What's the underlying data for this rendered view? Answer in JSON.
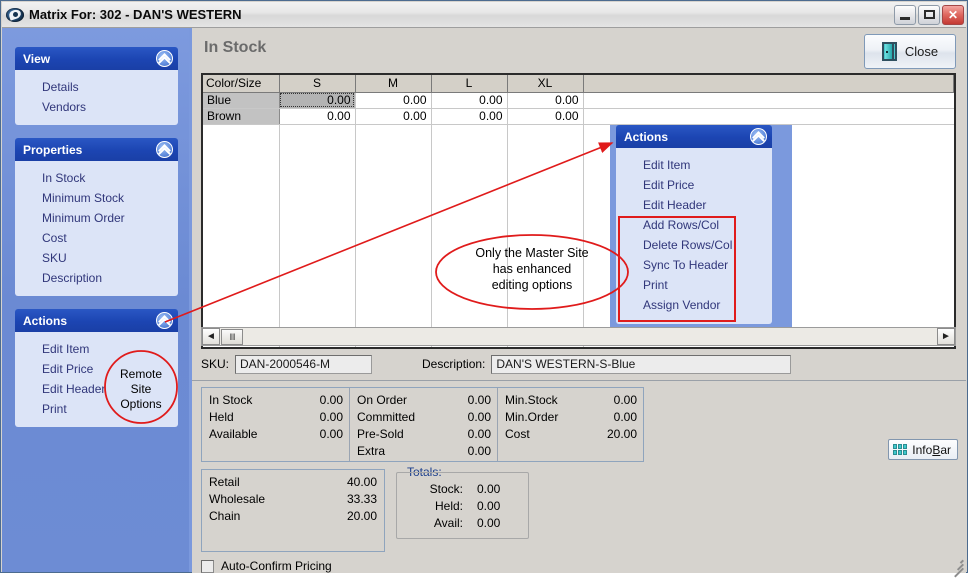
{
  "window": {
    "title": "Matrix For: 302 - DAN'S WESTERN",
    "app_icon": "matrix-logo-icon",
    "minimize_label": "_",
    "maximize_label": "□",
    "close_label": "✕"
  },
  "content": {
    "page_title": "In Stock",
    "close_button": {
      "label": "Close",
      "icon": "exit-door-icon"
    }
  },
  "sidebar": {
    "panels": [
      {
        "title": "View",
        "collapse_icon": "chevron-up-icon",
        "items": [
          {
            "label": "Details"
          },
          {
            "label": "Vendors"
          }
        ]
      },
      {
        "title": "Properties",
        "collapse_icon": "chevron-up-icon",
        "items": [
          {
            "label": "In Stock"
          },
          {
            "label": "Minimum Stock"
          },
          {
            "label": "Minimum Order"
          },
          {
            "label": "Cost"
          },
          {
            "label": "SKU"
          },
          {
            "label": "Description"
          }
        ]
      },
      {
        "title": "Actions",
        "collapse_icon": "chevron-up-icon",
        "items": [
          {
            "label": "Edit Item"
          },
          {
            "label": "Edit Price"
          },
          {
            "label": "Edit Header"
          },
          {
            "label": "Print"
          }
        ]
      }
    ]
  },
  "floating_actions": {
    "title": "Actions",
    "collapse_icon": "chevron-up-icon",
    "items": [
      {
        "label": "Edit Item",
        "highlighted": false
      },
      {
        "label": "Edit Price",
        "highlighted": false
      },
      {
        "label": "Edit Header",
        "highlighted": false
      },
      {
        "label": "Add Rows/Col",
        "highlighted": true
      },
      {
        "label": "Delete Rows/Col",
        "highlighted": true
      },
      {
        "label": "Sync To Header",
        "highlighted": true
      },
      {
        "label": "Print",
        "highlighted": true
      },
      {
        "label": "Assign Vendor",
        "highlighted": true
      }
    ]
  },
  "matrix": {
    "columns": [
      "Color/Size",
      "S",
      "M",
      "L",
      "XL",
      ""
    ],
    "rows": [
      {
        "label": "Blue",
        "values": [
          "0.00",
          "0.00",
          "0.00",
          "0.00"
        ],
        "selected_index": 0
      },
      {
        "label": "Brown",
        "values": [
          "0.00",
          "0.00",
          "0.00",
          "0.00"
        ],
        "selected_index": -1
      }
    ],
    "scrollbar": {
      "left_arrow": "◄",
      "right_arrow": "►",
      "thumb_grip": "‖‖"
    }
  },
  "fields": {
    "sku_label": "SKU:",
    "sku_value": "DAN-2000546-M",
    "description_label": "Description:",
    "description_value": "DAN'S WESTERN-S-Blue"
  },
  "stats": {
    "column1": [
      {
        "key": "In Stock",
        "value": "0.00"
      },
      {
        "key": "Held",
        "value": "0.00"
      },
      {
        "key": "Available",
        "value": "0.00"
      }
    ],
    "column2": [
      {
        "key": "On Order",
        "value": "0.00"
      },
      {
        "key": "Committed",
        "value": "0.00"
      },
      {
        "key": "Pre-Sold",
        "value": "0.00"
      },
      {
        "key": "Extra",
        "value": "0.00"
      }
    ],
    "column3": [
      {
        "key": "Min.Stock",
        "value": "0.00"
      },
      {
        "key": "Min.Order",
        "value": "0.00"
      },
      {
        "key": "Cost",
        "value": "20.00"
      }
    ]
  },
  "pricing": [
    {
      "key": "Retail",
      "value": "40.00"
    },
    {
      "key": "Wholesale",
      "value": "33.33"
    },
    {
      "key": "Chain",
      "value": "20.00"
    }
  ],
  "totals": {
    "legend": "Totals:",
    "rows": [
      {
        "key": "Stock:",
        "value": "0.00"
      },
      {
        "key": "Held:",
        "value": "0.00"
      },
      {
        "key": "Avail:",
        "value": "0.00"
      }
    ]
  },
  "auto_confirm": {
    "label": "Auto-Confirm Pricing",
    "checked": false
  },
  "infobar": {
    "label_before": "Info",
    "label_accel": "B",
    "label_after": "ar",
    "icon": "grid-squares-icon"
  },
  "annotations": {
    "master_site": {
      "lines": [
        "Only the Master Site",
        "has enhanced",
        "editing options"
      ],
      "shape": "ellipse",
      "color": "#e01b1b"
    },
    "remote_site": {
      "lines": [
        "Remote",
        "Site",
        "Options"
      ],
      "shape": "circle",
      "color": "#e01b1b"
    },
    "arrow": {
      "color": "#e01b1b",
      "from": "sidebar-actions-panel",
      "to": "floating-actions-panel"
    },
    "highlight_box": {
      "color": "#e01b1b",
      "target": "enhanced-action-items"
    }
  },
  "colors": {
    "titlebar": "#e8e8e8",
    "panel_header_blue": "#1c45b2",
    "panel_body_blue": "#dce4f7",
    "sidebar_blue": "#6f8fd6",
    "content_gray": "#d6d3ce",
    "annotation_red": "#e01b1b",
    "link_text": "#30367a"
  }
}
